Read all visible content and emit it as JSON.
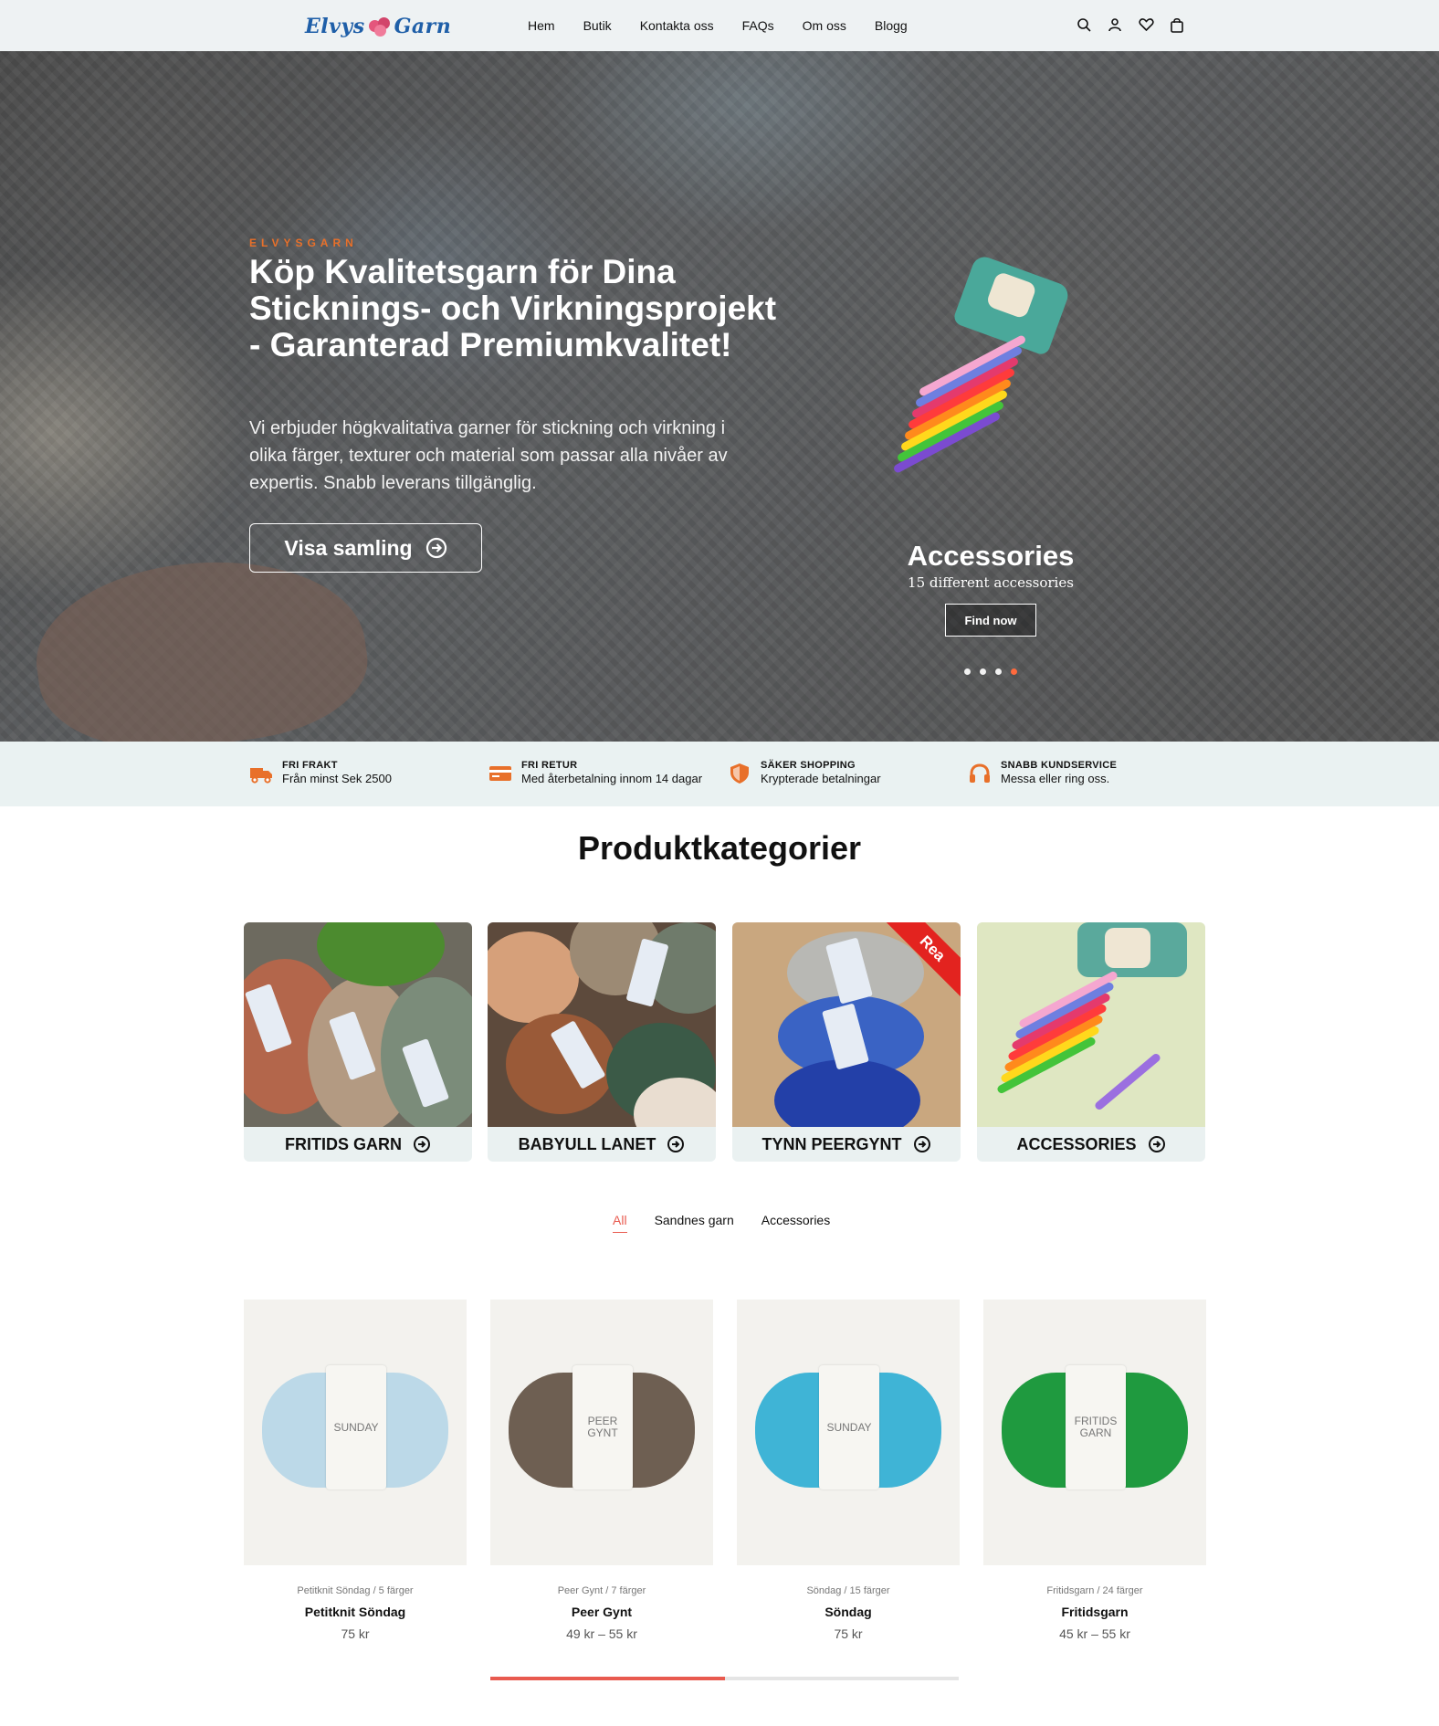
{
  "header": {
    "logo_text_left": "Elvys",
    "logo_text_right": "Garn",
    "nav": [
      "Hem",
      "Butik",
      "Kontakta oss",
      "FAQs",
      "Om oss",
      "Blogg"
    ],
    "icons": [
      "search-icon",
      "user-icon",
      "heart-icon",
      "bag-icon"
    ]
  },
  "hero": {
    "kicker": "ELVYSGARN",
    "title": "Köp Kvalitetsgarn för Dina Sticknings- och Virkningsprojekt - Garanterad Premiumkvalitet!",
    "description": "Vi erbjuder högkvalitativa garner för stickning och virkning i olika färger, texturer och material som passar alla nivåer av expertis. Snabb leverans tillgänglig.",
    "button_label": "Visa samling",
    "promo": {
      "title": "Accessories",
      "subtitle": "15 different accessories",
      "button_label": "Find now"
    },
    "slides_count": 4,
    "active_slide": 4
  },
  "features": [
    {
      "title": "FRI FRAKT",
      "desc": "Från minst Sek 2500",
      "icon": "truck-icon"
    },
    {
      "title": "FRI RETUR",
      "desc": "Med återbetalning innom 14 dagar",
      "icon": "card-icon"
    },
    {
      "title": "SÄKER SHOPPING",
      "desc": "Krypterade betalningar",
      "icon": "shield-icon"
    },
    {
      "title": "SNABB KUNDSERVICE",
      "desc": "Messa eller ring oss.",
      "icon": "headphones-icon"
    }
  ],
  "categories_title": "Produktkategorier",
  "categories": [
    {
      "label": "FRITIDS GARN"
    },
    {
      "label": "BABYULL LANET"
    },
    {
      "label": "TYNN PEERGYNT",
      "badge": "Rea"
    },
    {
      "label": "ACCESSORIES"
    }
  ],
  "tabs": [
    "All",
    "Sandnes garn",
    "Accessories"
  ],
  "active_tab": "All",
  "products": [
    {
      "meta": "Petitknit Söndag / 5 färger",
      "name": "Petitknit Söndag",
      "price": "75 kr",
      "band": "SUNDAY",
      "color": "#bcd9e8"
    },
    {
      "meta": "Peer Gynt / 7 färger",
      "name": "Peer Gynt",
      "price": "49 kr – 55 kr",
      "band": "PEER GYNT",
      "color": "#6e5f52"
    },
    {
      "meta": "Söndag / 15 färger",
      "name": "Söndag",
      "price": "75 kr",
      "band": "SUNDAY",
      "color": "#3fb4d6"
    },
    {
      "meta": "Fritidsgarn / 24 färger",
      "name": "Fritidsgarn",
      "price": "45 kr – 55 kr",
      "band": "FRITIDS GARN",
      "color": "#1f9a3f"
    }
  ],
  "carousel_progress": 0.5,
  "colors": {
    "accent": "#e85a4f",
    "orange": "#e8702a",
    "logo_blue": "#1f5fa8",
    "features_bg": "#eaf2f2"
  }
}
